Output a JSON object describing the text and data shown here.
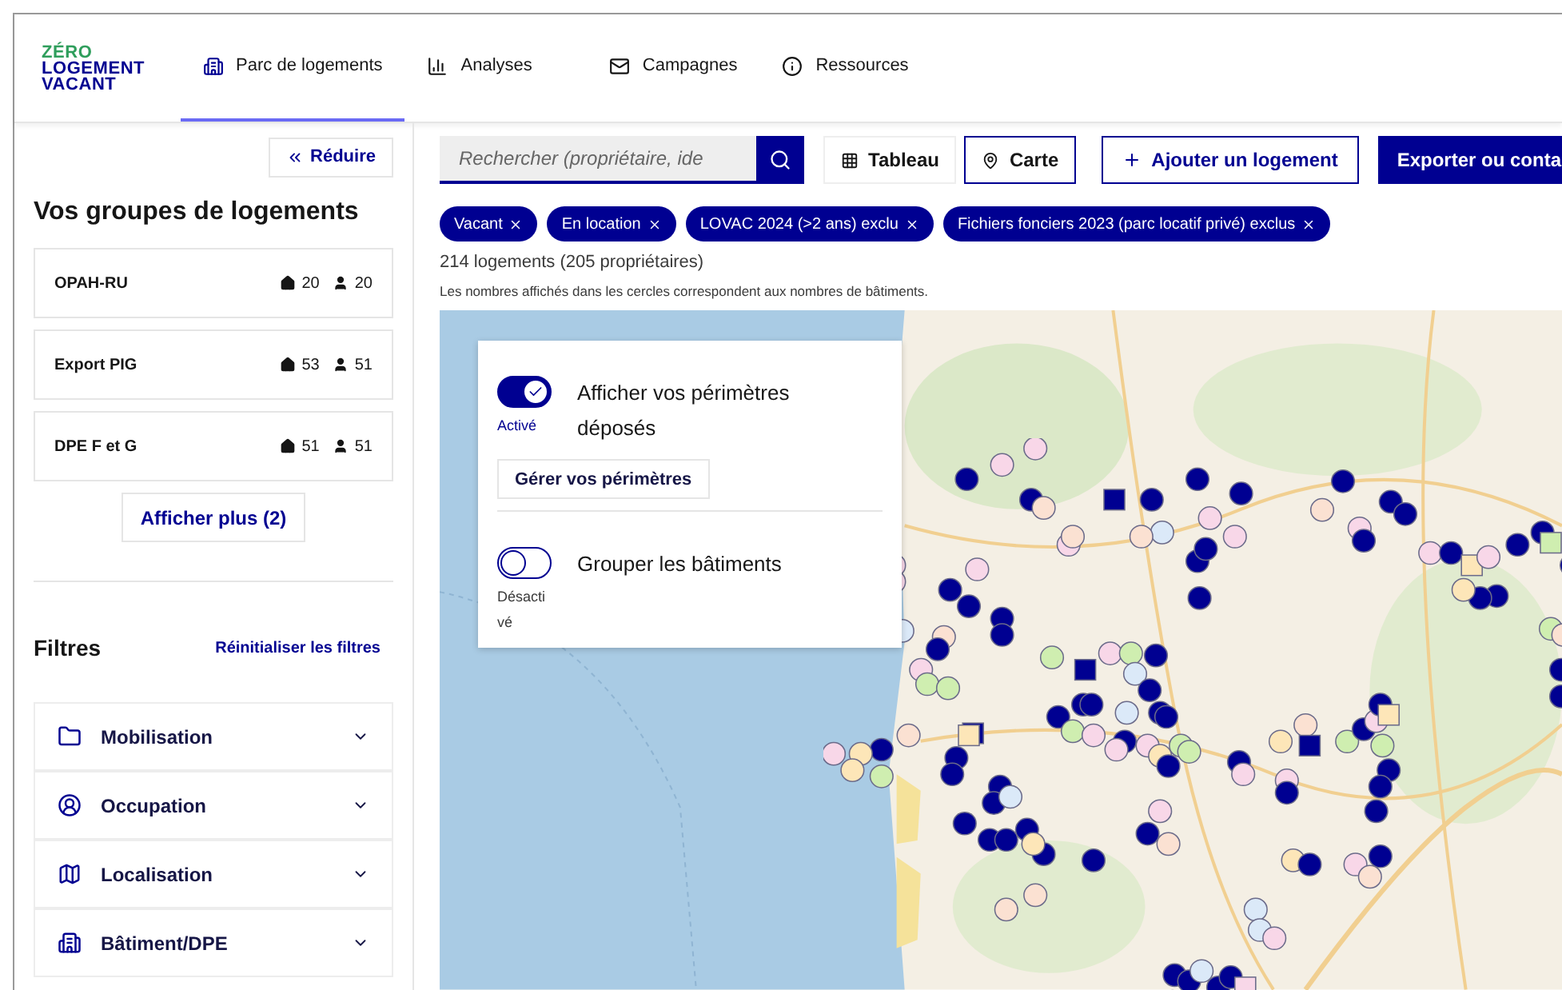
{
  "header": {
    "logo": [
      "ZÉRO",
      "LOGEMENT",
      "VACANT"
    ],
    "nav": [
      {
        "label": "Parc de logements",
        "selected": true
      },
      {
        "label": "Analyses",
        "selected": false
      },
      {
        "label": "Campagnes",
        "selected": false
      },
      {
        "label": "Ressources",
        "selected": false
      }
    ]
  },
  "sidebar": {
    "collapse_button": "Réduire",
    "groups_title": "Vos groupes de logements",
    "groups": [
      {
        "name": "OPAH-RU",
        "housing": "20",
        "owners": "20"
      },
      {
        "name": "Export PIG",
        "housing": "53",
        "owners": "51"
      },
      {
        "name": "DPE F et G",
        "housing": "51",
        "owners": "51"
      }
    ],
    "show_more": "Afficher plus (2)",
    "filters_title": "Filtres",
    "reset_filters": "Réinitialiser les filtres",
    "filters": [
      {
        "label": "Mobilisation"
      },
      {
        "label": "Occupation"
      },
      {
        "label": "Localisation"
      },
      {
        "label": "Bâtiment/DPE"
      }
    ]
  },
  "toolbar": {
    "search": {
      "placeholder": "Rechercher (propriétaire, ide"
    },
    "views": [
      {
        "label": "Tableau",
        "selected": false
      },
      {
        "label": "Carte",
        "selected": true
      }
    ],
    "add_button": "Ajouter un logement",
    "export_button": "Exporter ou conta"
  },
  "chips": [
    "Vacant",
    "En location",
    "LOVAC 2024 (>2 ans) exclu",
    "Fichiers fonciers 2023 (parc locatif privé) exclus"
  ],
  "count": "214 logements (205 propriétaires)",
  "note": "Les nombres affichés dans les cercles correspondent aux nombres de bâtiments.",
  "map_panel": {
    "toggles": [
      {
        "label": "Afficher vos périmètres déposés",
        "status": "Activé",
        "on": true
      },
      {
        "label": "Grouper les bâtiments",
        "status": "Désactivé",
        "on": false
      }
    ],
    "manage_button": "Gérer vos périmètres"
  }
}
